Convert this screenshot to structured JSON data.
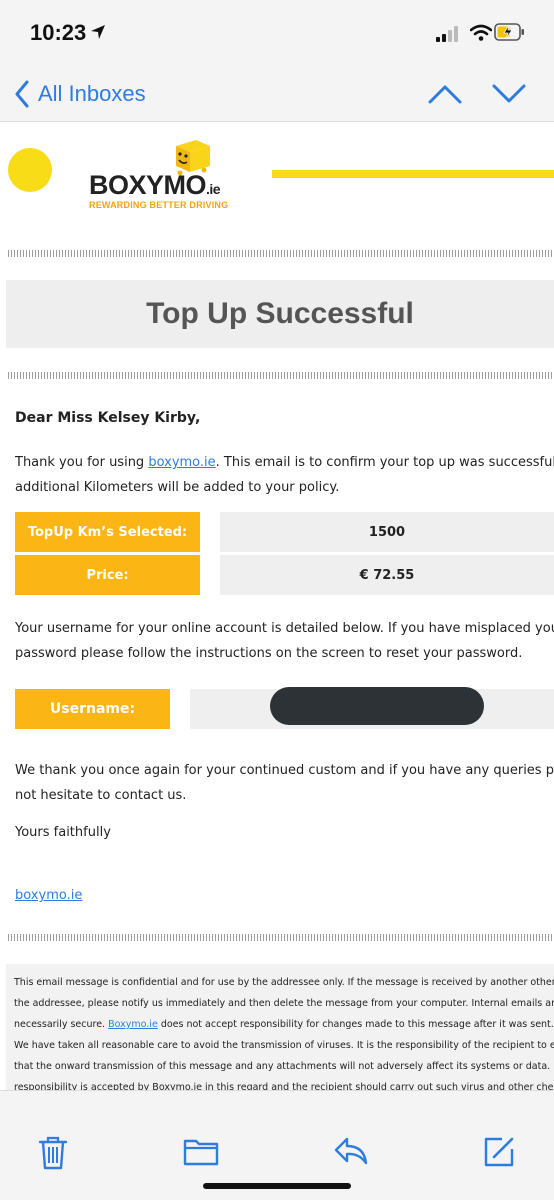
{
  "status_bar": {
    "time": "10:23"
  },
  "nav": {
    "back_label": "All Inboxes"
  },
  "logo": {
    "brand": "BOXYMO",
    "suffix": ".ie",
    "tagline": "REWARDING BETTER DRIVING"
  },
  "email": {
    "title": "Top Up Successful",
    "greeting": "Dear Miss Kelsey Kirby,",
    "intro": {
      "pre_link": "Thank you for using ",
      "link": "boxymo.ie",
      "post_link": ". This email is to confirm your top up was successful and th",
      "line2": "additional Kilometers will be added to your policy."
    },
    "topup": {
      "km_label": "TopUp Km’s Selected:",
      "km_value": "1500",
      "price_label": "Price:",
      "price_value": "€ 72.55"
    },
    "username_info": {
      "line1": "Your username for your online account is detailed below. If you have misplaced your",
      "line2": "password please follow the instructions on the screen to reset your password."
    },
    "username_label": "Username:",
    "thanks": {
      "line1": "We thank you once again for your continued custom and if you have any queries please do",
      "line2": "not hesitate to contact us."
    },
    "signoff": "Yours faithfully",
    "signature_link": "boxymo.ie",
    "disclaimer": {
      "line1": "This email message is confidential and for use by the addressee only. If the message is received by another other than",
      "line2": "the addressee, please notify us immediately and then delete the message from your computer. Internal emails are not",
      "line3_pre": "necessarily secure. ",
      "line3_link": "Boxymo.ie",
      "line3_post": " does not accept responsibility for changes made to this message after it was sent.",
      "line4": "We have taken all reasonable care to avoid the transmission of viruses. It is the responsibility of the recipient to ensure",
      "line5": "that the onward transmission of this message and any attachments will not adversely affect its systems or data. No",
      "line6": "responsibility is accepted by Boxymo.ie in this regard and the recipient should carry out such virus and other checks as"
    }
  },
  "colors": {
    "accent": "#2f7ce0",
    "brand_yellow": "#f8dc18",
    "cell_orange": "#fbb515"
  },
  "toolbar": {
    "icons": [
      "trash-icon",
      "folder-icon",
      "reply-icon",
      "compose-icon"
    ]
  }
}
